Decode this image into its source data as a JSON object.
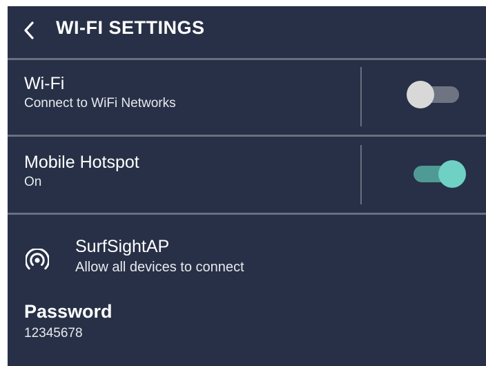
{
  "header": {
    "title": "WI-FI SETTINGS",
    "back_icon": "chevron-left-icon"
  },
  "wifi": {
    "title": "Wi-Fi",
    "subtitle": "Connect to WiFi Networks",
    "enabled": false
  },
  "hotspot": {
    "title": "Mobile Hotspot",
    "subtitle": "On",
    "enabled": true
  },
  "access_point": {
    "icon": "hotspot-signal-icon",
    "name": "SurfSightAP",
    "description": "Allow all devices to connect"
  },
  "password": {
    "label": "Password",
    "value": "12345678"
  },
  "colors": {
    "background": "#273046",
    "divider": "#6a7080",
    "toggle_on_knob": "#6fd0c4",
    "toggle_on_track": "#4f9a94",
    "toggle_off_knob": "#d8d8d8",
    "toggle_off_track": "#6e7482"
  }
}
